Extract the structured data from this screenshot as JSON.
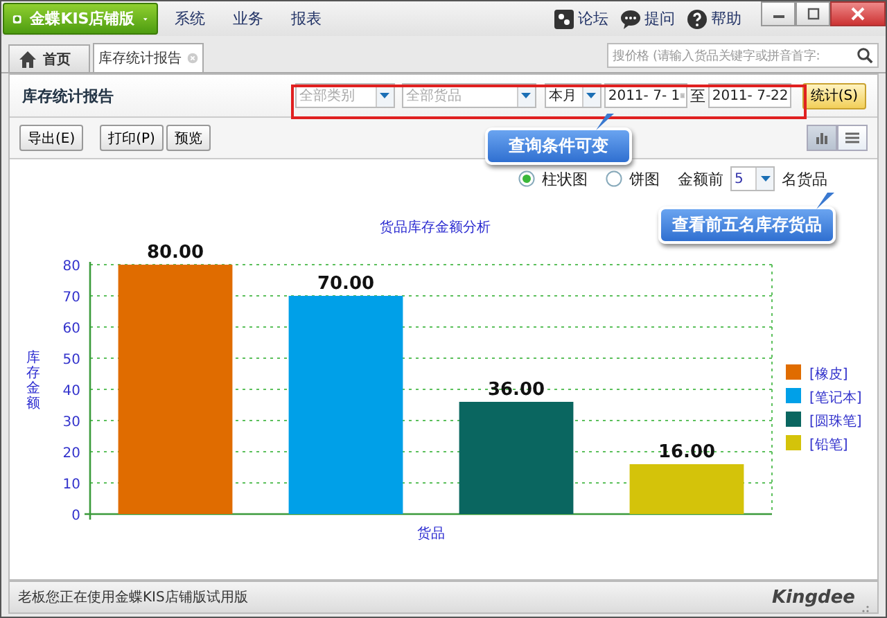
{
  "window": {
    "app_button": "金蝶KIS店铺版",
    "menu": [
      "系统",
      "业务",
      "报表"
    ],
    "links": [
      {
        "label": "论坛",
        "kind": "forum"
      },
      {
        "label": "提问",
        "kind": "ask"
      },
      {
        "label": "帮助",
        "kind": "help"
      }
    ]
  },
  "tabs": [
    {
      "label": "首页",
      "selected": false,
      "kind": "home"
    },
    {
      "label": "库存统计报告",
      "selected": true,
      "kind": "closable"
    }
  ],
  "search": {
    "placeholder": "搜价格 (请输入货品关键字或拼音首字:"
  },
  "report": {
    "title": "库存统计报告",
    "filters": [
      {
        "kind": "select",
        "placeholder": "全部类别"
      },
      {
        "kind": "select",
        "placeholder": "全部货品"
      },
      {
        "kind": "select",
        "value": "本月"
      },
      {
        "kind": "date",
        "value": "2011- 7- 1"
      },
      {
        "kind": "sep",
        "text": "至"
      },
      {
        "kind": "date",
        "value": "2011- 7-22"
      }
    ],
    "run_button": "统计(S)",
    "buttons": [
      "导出(E)",
      "打印(P)",
      "预览"
    ],
    "views": [
      {
        "kind": "chart",
        "selected": true
      },
      {
        "kind": "list",
        "selected": false
      }
    ],
    "chart_types": [
      {
        "label": "柱状图",
        "selected": true
      },
      {
        "label": "饼图",
        "selected": false
      }
    ],
    "top_prefix": "金额前",
    "top_value": "5",
    "top_suffix": "名货品",
    "chart_data": {
      "type": "bar",
      "title": "货品库存金额分析",
      "xlabel": "货品",
      "ylabel": "库存金额",
      "grid": true,
      "legend": "right",
      "series": [
        {
          "name": "[橡皮]",
          "color": "#e06c00",
          "values": [
            80
          ]
        },
        {
          "name": "[笔记本]",
          "color": "#00a0e8",
          "values": [
            70
          ]
        },
        {
          "name": "[圆珠笔]",
          "color": "#0a6660",
          "values": [
            36
          ]
        },
        {
          "name": "[铅笔]",
          "color": "#d4c30a",
          "values": [
            16
          ]
        }
      ],
      "ylim": [
        0,
        80
      ],
      "yticks": [
        0,
        10,
        20,
        30,
        40,
        50,
        60,
        70,
        80
      ],
      "value_labels": [
        "80.00",
        "70.00",
        "36.00",
        "16.00"
      ]
    }
  },
  "callouts": [
    {
      "text": "查询条件可变",
      "kind": "filters"
    },
    {
      "text": "查看前五名库存货品",
      "kind": "top"
    }
  ],
  "status_bar": {
    "text": "老板您正在使用金蝶KIS店铺版试用版",
    "logo": "Kingdee"
  }
}
